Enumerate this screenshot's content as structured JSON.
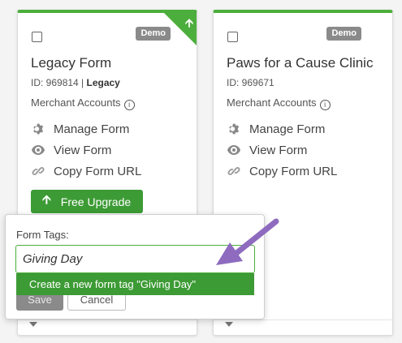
{
  "cards": [
    {
      "demo_badge": "Demo",
      "title": "Legacy Form",
      "id_text": "ID: 969814 | ",
      "id_tag": "Legacy",
      "merchant_label": "Merchant Accounts",
      "actions": [
        "Manage Form",
        "View Form",
        "Copy Form URL"
      ],
      "upgrade_label": "Free Upgrade"
    },
    {
      "demo_badge": "Demo",
      "title": "Paws for a Cause Clinic",
      "id_text": "ID: 969671",
      "merchant_label": "Merchant Accounts",
      "actions": [
        "Manage Form",
        "View Form",
        "Copy Form URL"
      ]
    }
  ],
  "popup": {
    "label": "Form Tags:",
    "input_value": "Giving Day",
    "suggestion": "Create a new form tag \"Giving Day\"",
    "save_label": "Save",
    "cancel_label": "Cancel"
  },
  "colors": {
    "accent_green": "#4cae3c",
    "button_green": "#3d9b35",
    "badge_gray": "#8a8a8a",
    "annotation_purple": "#8e6bbf"
  },
  "icons": [
    "checkbox",
    "upgrade-arrow-icon",
    "info-icon",
    "gear-icon",
    "eye-icon",
    "link-icon",
    "up-arrow-icon",
    "chevron-down-icon",
    "annotation-arrow"
  ]
}
